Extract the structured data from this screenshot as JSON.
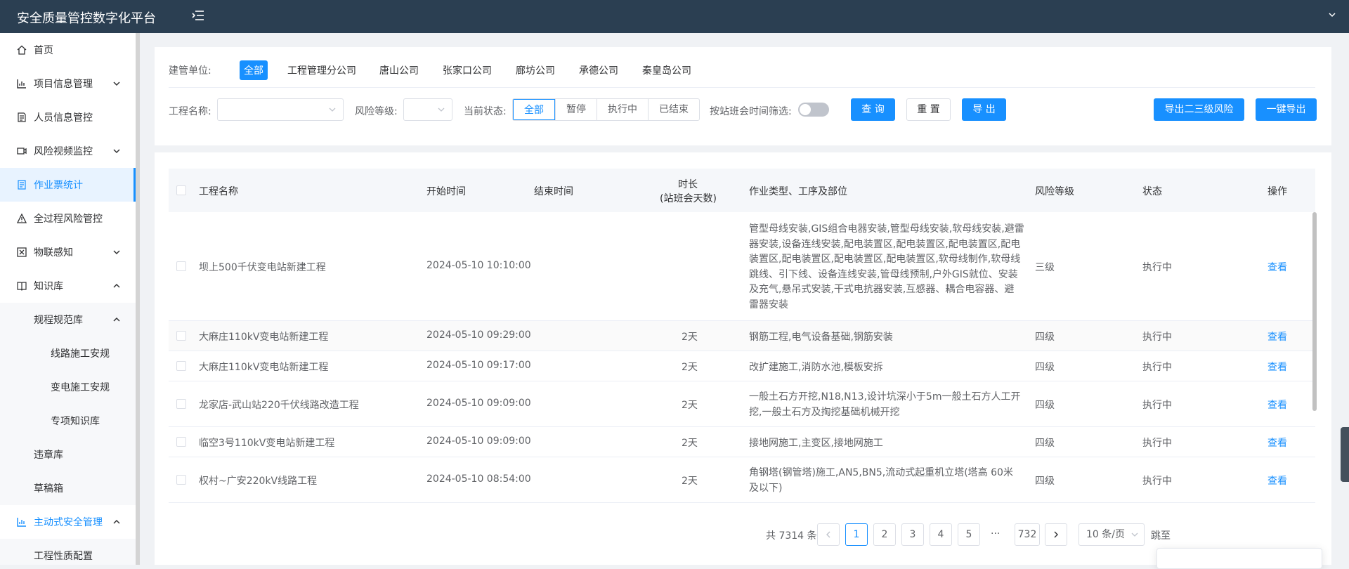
{
  "app": {
    "title": "安全质量管控数字化平台"
  },
  "sidebar": {
    "items": [
      {
        "label": "首页",
        "icon": "home-icon"
      },
      {
        "label": "项目信息管理",
        "icon": "bar-chart-icon"
      },
      {
        "label": "人员信息管控",
        "icon": "document-icon"
      },
      {
        "label": "风险视频监控",
        "icon": "video-icon"
      },
      {
        "label": "作业票统计",
        "icon": "ticket-icon"
      },
      {
        "label": "全过程风险管控",
        "icon": "warning-icon"
      },
      {
        "label": "物联感知",
        "icon": "box-icon"
      },
      {
        "label": "知识库",
        "icon": "book-icon"
      },
      {
        "label": "规程规范库"
      },
      {
        "label": "线路施工安规"
      },
      {
        "label": "变电施工安规"
      },
      {
        "label": "专项知识库"
      },
      {
        "label": "违章库"
      },
      {
        "label": "草稿箱"
      },
      {
        "label": "主动式安全管理",
        "icon": "bar-chart-icon"
      },
      {
        "label": "工程性质配置"
      }
    ]
  },
  "filters": {
    "unit_label": "建管单位:",
    "units": [
      "全部",
      "工程管理分公司",
      "唐山公司",
      "张家口公司",
      "廊坊公司",
      "承德公司",
      "秦皇岛公司"
    ],
    "project_label": "工程名称:",
    "project_value": "",
    "risk_label": "风险等级:",
    "risk_value": "",
    "status_label": "当前状态:",
    "status_options": [
      "全部",
      "暂停",
      "执行中",
      "已结束"
    ],
    "meeting_filter_label": "按站班会时间筛选:",
    "query_button": "查 询",
    "reset_button": "重 置",
    "export_button": "导 出",
    "export_risk_button": "导出二三级风险",
    "export_all_button": "一键导出"
  },
  "table": {
    "headers": {
      "name": "工程名称",
      "start": "开始时间",
      "end": "结束时间",
      "duration_line1": "时长",
      "duration_line2": "(站班会天数)",
      "work": "作业类型、工序及部位",
      "risk": "风险等级",
      "status": "状态",
      "action": "操作"
    },
    "rows": [
      {
        "name": "坝上500千伏变电站新建工程",
        "start": "2024-05-10 10:10:00",
        "end": "",
        "duration": "",
        "work_lines": [
          "管型母线安装,GIS组合电器安装,管型母线安装,软母线安装,避雷",
          "器安装,设备连线安装,配电装置区,配电装置区,配电装置区,配电",
          "装置区,配电装置区,配电装置区,配电装置区,软母线制作,软母线",
          "跳线、引下线、设备连线安装,管母线预制,户外GIS就位、安装",
          "及充气,悬吊式安装,干式电抗器安装,互感器、耦合电容器、避",
          "雷器安装"
        ],
        "risk": "三级",
        "status": "执行中",
        "action": "查看"
      },
      {
        "name": "大麻庄110kV变电站新建工程",
        "start": "2024-05-10 09:29:00",
        "end": "",
        "duration": "2天",
        "work_lines": [
          "钢筋工程,电气设备基础,钢筋安装"
        ],
        "risk": "四级",
        "status": "执行中",
        "action": "查看"
      },
      {
        "name": "大麻庄110kV变电站新建工程",
        "start": "2024-05-10 09:17:00",
        "end": "",
        "duration": "2天",
        "work_lines": [
          "改扩建施工,消防水池,模板安拆"
        ],
        "risk": "四级",
        "status": "执行中",
        "action": "查看"
      },
      {
        "name": "龙家店-武山站220千伏线路改造工程",
        "start": "2024-05-10 09:09:00",
        "end": "",
        "duration": "2天",
        "work_lines": [
          "一般土石方开挖,N18,N13,设计坑深小于5m一般土石方人工开",
          "挖,一般土石方及掏挖基础机械开挖"
        ],
        "risk": "四级",
        "status": "执行中",
        "action": "查看"
      },
      {
        "name": "临空3号110kV变电站新建工程",
        "start": "2024-05-10 09:09:00",
        "end": "",
        "duration": "2天",
        "work_lines": [
          "接地网施工,主变区,接地网施工"
        ],
        "risk": "四级",
        "status": "执行中",
        "action": "查看"
      },
      {
        "name": "权村~广安220kV线路工程",
        "start": "2024-05-10 08:54:00",
        "end": "",
        "duration": "2天",
        "work_lines": [
          "角钢塔(钢管塔)施工,AN5,BN5,流动式起重机立塔(塔高 60米",
          "及以下)"
        ],
        "risk": "四级",
        "status": "执行中",
        "action": "查看"
      }
    ]
  },
  "pagination": {
    "total": "共 7314 条",
    "pages": [
      "1",
      "2",
      "3",
      "4",
      "5"
    ],
    "ellipsis": "···",
    "last_page": "732",
    "page_size": "10 条/页",
    "jump_label": "跳至"
  },
  "colors": {
    "accent": "#1890ff",
    "topbar": "#2b3f52"
  }
}
